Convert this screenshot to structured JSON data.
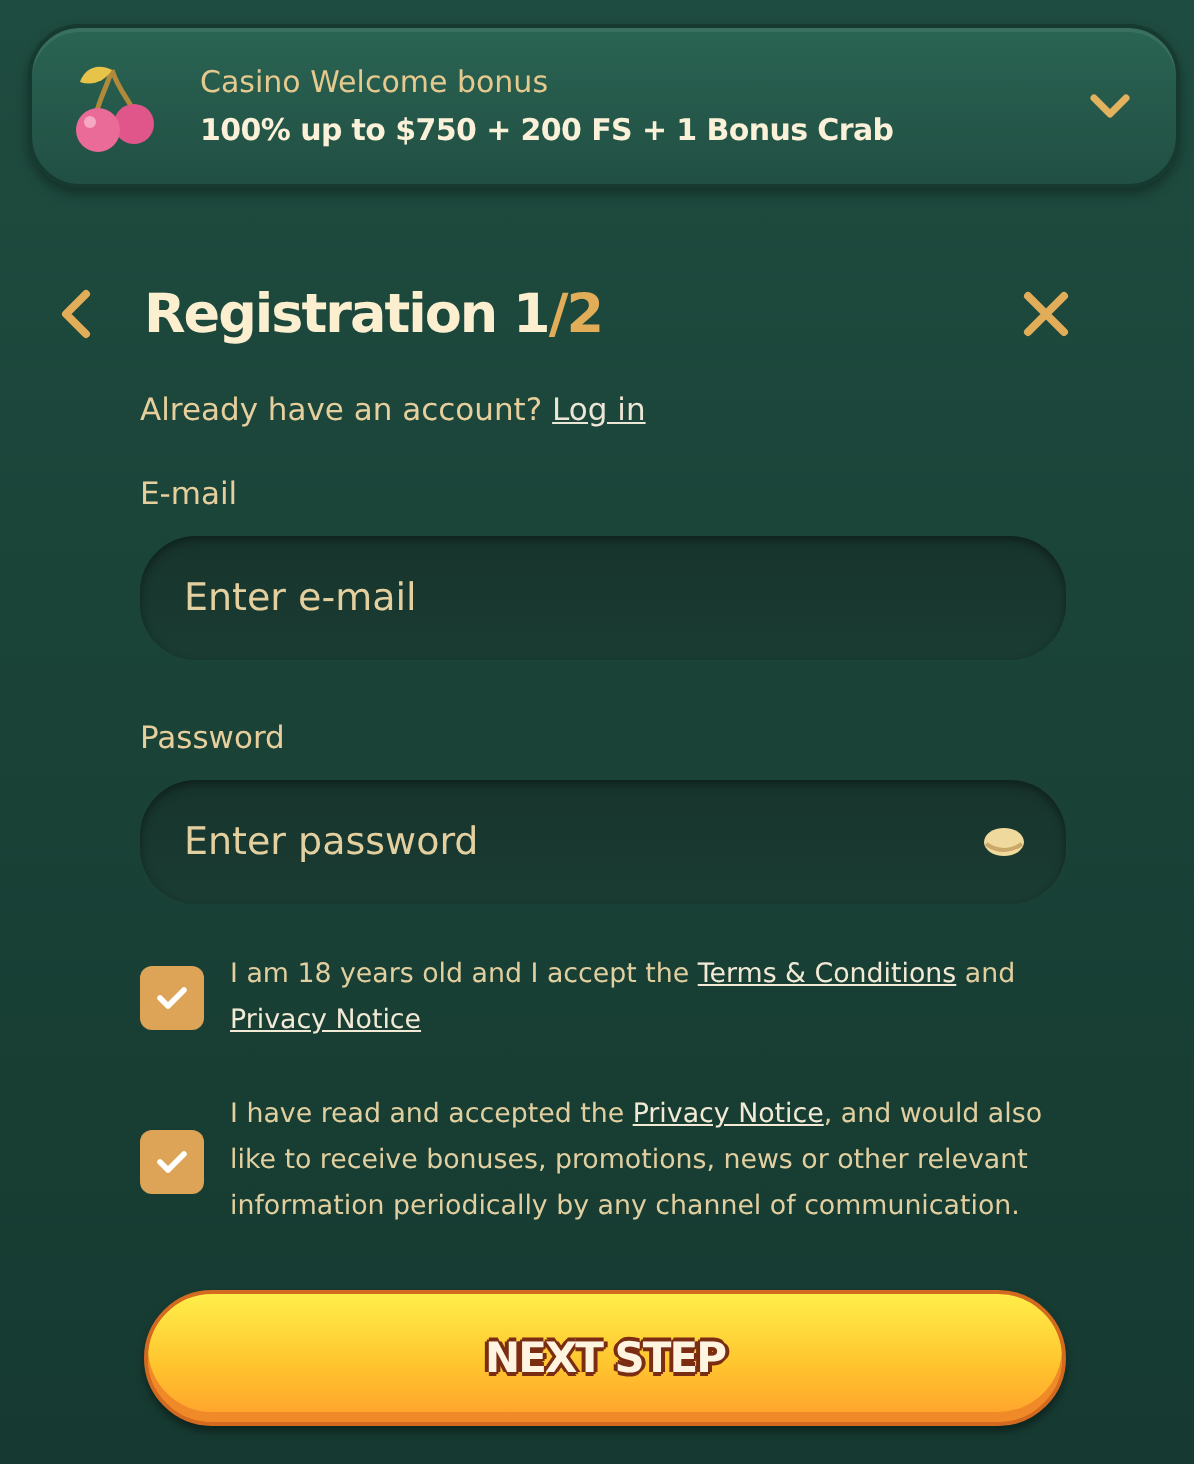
{
  "bonus": {
    "label": "Casino Welcome bonus",
    "offer": "100% up to $750 + 200 FS + 1 Bonus Crab",
    "expanded": false
  },
  "header": {
    "title": "Registration 1",
    "step": "/2"
  },
  "login_prompt": {
    "text": "Already have an account?",
    "link": "Log in"
  },
  "fields": [
    {
      "label": "E-mail",
      "placeholder": "Enter e-mail",
      "kind": "email"
    },
    {
      "label": "Password",
      "placeholder": "Enter password",
      "kind": "password"
    }
  ],
  "consents": [
    {
      "checked": true,
      "parts": [
        {
          "kind": "text",
          "text": "I am 18 years old and I accept the "
        },
        {
          "kind": "link",
          "text": "Terms & Conditions"
        },
        {
          "kind": "text",
          "text": " and "
        },
        {
          "kind": "link",
          "text": "Privacy Notice"
        }
      ]
    },
    {
      "checked": true,
      "parts": [
        {
          "kind": "text",
          "text": "I have read and accepted the "
        },
        {
          "kind": "link",
          "text": "Privacy Notice"
        },
        {
          "kind": "text",
          "text": ", and would also like to receive bonuses, promotions, news or other relevant information periodically by any channel of communication."
        }
      ]
    }
  ],
  "submit": "NEXT STEP"
}
